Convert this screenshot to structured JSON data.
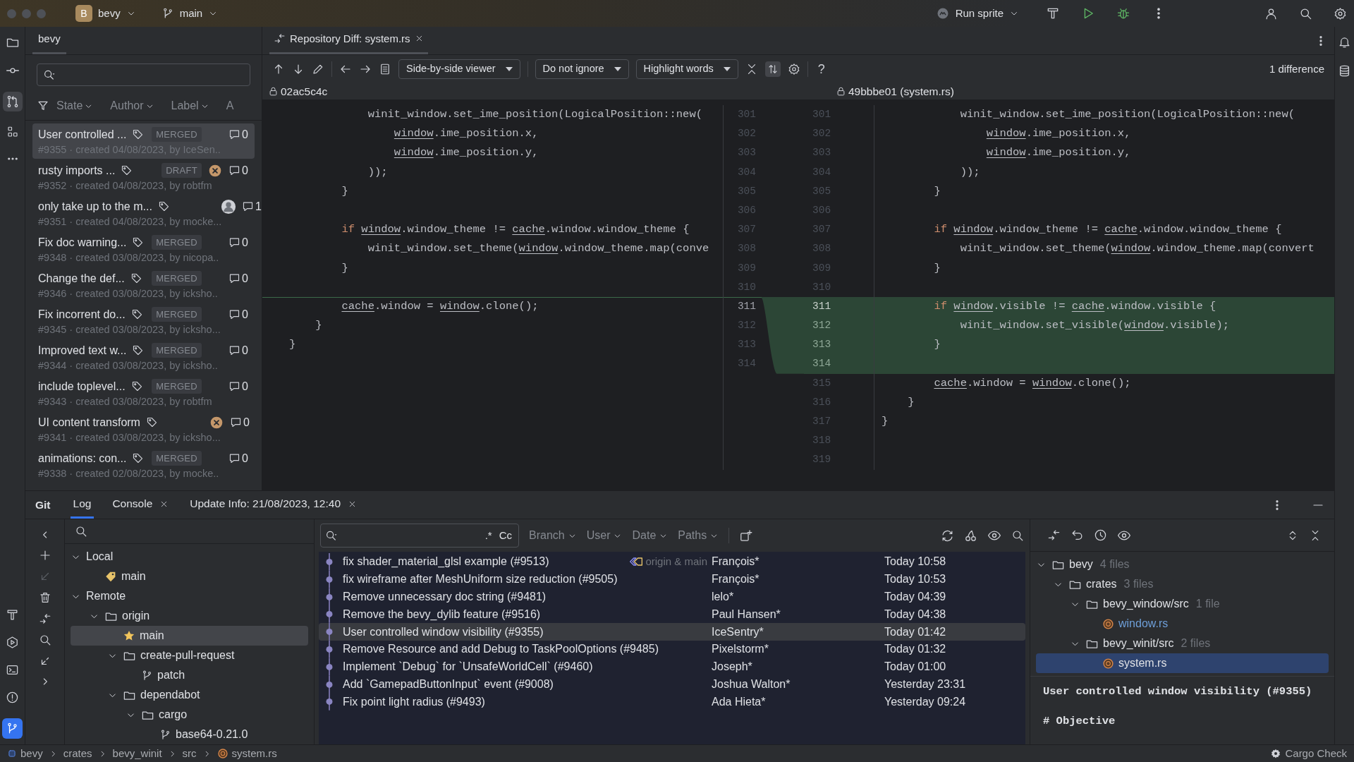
{
  "title_bar": {
    "project_initial": "B",
    "project": "bevy",
    "branch": "main",
    "run_config": "Run sprite"
  },
  "pr_panel": {
    "tab": "bevy",
    "filters": [
      "State",
      "Author",
      "Label",
      "A"
    ],
    "items": [
      {
        "title": "User controlled ...",
        "status": "MERGED",
        "failed": false,
        "avatar": false,
        "comments": "0",
        "meta": "#9355 · created 04/08/2023, by IceSen..",
        "selected": true
      },
      {
        "title": "rusty imports ...",
        "status": "DRAFT",
        "failed": true,
        "avatar": false,
        "comments": "0",
        "meta": "#9352 · created 04/08/2023, by robtfm",
        "selected": false
      },
      {
        "title": "only take up to the m...",
        "failed": false,
        "avatar": true,
        "comments": "1",
        "meta": "#9351 · created 04/08/2023, by mocke...",
        "selected": false
      },
      {
        "title": "Fix doc warning...",
        "status": "MERGED",
        "failed": false,
        "avatar": false,
        "comments": "0",
        "meta": "#9348 · created 03/08/2023, by nicopa..",
        "selected": false
      },
      {
        "title": "Change the def...",
        "status": "MERGED",
        "failed": false,
        "avatar": false,
        "comments": "0",
        "meta": "#9346 · created 03/08/2023, by icksho..",
        "selected": false
      },
      {
        "title": "Fix incorrent do...",
        "status": "MERGED",
        "failed": false,
        "avatar": false,
        "comments": "0",
        "meta": "#9345 · created 03/08/2023, by icksho...",
        "selected": false
      },
      {
        "title": "Improved text w...",
        "status": "MERGED",
        "failed": false,
        "avatar": false,
        "comments": "0",
        "meta": "#9344 · created 03/08/2023, by icksho..",
        "selected": false
      },
      {
        "title": "include toplevel...",
        "status": "MERGED",
        "failed": false,
        "avatar": false,
        "comments": "0",
        "meta": "#9343 · created 03/08/2023, by robtfm",
        "selected": false
      },
      {
        "title": "UI content transform",
        "failed": true,
        "avatar": false,
        "comments": "0",
        "meta": "#9341 · created 03/08/2023, by icksho...",
        "selected": false
      },
      {
        "title": "animations: con...",
        "status": "MERGED",
        "failed": false,
        "avatar": false,
        "comments": "0",
        "meta": "#9338 · created 02/08/2023, by mocke..",
        "selected": false
      }
    ]
  },
  "diff": {
    "tab": "Repository Diff: system.rs",
    "dropdowns": [
      "Side-by-side viewer",
      "Do not ignore",
      "Highlight words"
    ],
    "sync_scroll": true,
    "help": "?",
    "differences": "1 difference",
    "left_revision": "02ac5c4c",
    "right_revision": "49bbbe01 (system.rs)",
    "rows": [
      {
        "left_num": "301",
        "left": [
          {
            "text": "            winit_window.set_ime_position(LogicalPosition::new(",
            "kind": "plain"
          }
        ],
        "right_num": "301",
        "right": [
          {
            "text": "            winit_window.set_ime_position(LogicalPosition::new(",
            "kind": "plain"
          }
        ],
        "changed": false
      },
      {
        "left_num": "302",
        "left": [
          {
            "text": "                window",
            "kind": "ref"
          },
          {
            "text": ".ime_position.x,",
            "kind": "plain"
          }
        ],
        "right_num": "302",
        "right": [
          {
            "text": "                window",
            "kind": "ref"
          },
          {
            "text": ".ime_position.x,",
            "kind": "plain"
          }
        ],
        "changed": false
      },
      {
        "left_num": "303",
        "left": [
          {
            "text": "                window",
            "kind": "ref"
          },
          {
            "text": ".ime_position.y,",
            "kind": "plain"
          }
        ],
        "right_num": "303",
        "right": [
          {
            "text": "                window",
            "kind": "ref"
          },
          {
            "text": ".ime_position.y,",
            "kind": "plain"
          }
        ],
        "changed": false
      },
      {
        "left_num": "304",
        "left": [
          {
            "text": "            ));",
            "kind": "plain"
          }
        ],
        "right_num": "304",
        "right": [
          {
            "text": "            ));",
            "kind": "plain"
          }
        ],
        "changed": false
      },
      {
        "left_num": "305",
        "left": [
          {
            "text": "        }",
            "kind": "plain"
          }
        ],
        "right_num": "305",
        "right": [
          {
            "text": "        }",
            "kind": "plain"
          }
        ],
        "changed": false
      },
      {
        "left_num": "306",
        "left": [],
        "right_num": "306",
        "right": [],
        "changed": false
      },
      {
        "left_num": "307",
        "left": [
          {
            "text": "        if",
            "kind": "keyword"
          },
          {
            "text": " window",
            "kind": "ref"
          },
          {
            "text": ".window_theme != ",
            "kind": "plain"
          },
          {
            "text": "cache",
            "kind": "ref"
          },
          {
            "text": ".window.window_theme {",
            "kind": "plain"
          }
        ],
        "right_num": "307",
        "right": [
          {
            "text": "        if",
            "kind": "keyword"
          },
          {
            "text": " window",
            "kind": "ref"
          },
          {
            "text": ".window_theme != ",
            "kind": "plain"
          },
          {
            "text": "cache",
            "kind": "ref"
          },
          {
            "text": ".window.window_theme {",
            "kind": "plain"
          }
        ],
        "changed": false
      },
      {
        "left_num": "308",
        "left": [
          {
            "text": "            winit_window.set_theme(",
            "kind": "plain"
          },
          {
            "text": "window",
            "kind": "ref"
          },
          {
            "text": ".window_theme.map(conve",
            "kind": "plain"
          }
        ],
        "right_num": "308",
        "right": [
          {
            "text": "            winit_window.set_theme(",
            "kind": "plain"
          },
          {
            "text": "window",
            "kind": "ref"
          },
          {
            "text": ".window_theme.map(convert",
            "kind": "plain"
          }
        ],
        "changed": false
      },
      {
        "left_num": "309",
        "left": [
          {
            "text": "        }",
            "kind": "plain"
          }
        ],
        "right_num": "309",
        "right": [
          {
            "text": "        }",
            "kind": "plain"
          }
        ],
        "changed": false
      },
      {
        "left_num": "310",
        "left": [],
        "right_num": "310",
        "right": [],
        "changed": false
      },
      {
        "left_num": "311",
        "left": [
          {
            "text": "        cache",
            "kind": "ref"
          },
          {
            "text": ".window = ",
            "kind": "plain"
          },
          {
            "text": "window",
            "kind": "ref"
          },
          {
            "text": ".clone();",
            "kind": "plain"
          }
        ],
        "right_num": "311",
        "right": [
          {
            "text": "        if",
            "kind": "keyword"
          },
          {
            "text": " window",
            "kind": "ref"
          },
          {
            "text": ".visible != ",
            "kind": "plain"
          },
          {
            "text": "cache",
            "kind": "ref"
          },
          {
            "text": ".window.visible {",
            "kind": "plain"
          }
        ],
        "changed": true
      },
      {
        "left_num": "312",
        "left": [
          {
            "text": "    }",
            "kind": "plain"
          }
        ],
        "right_num": "312",
        "right": [
          {
            "text": "            winit_window.set_visible(",
            "kind": "plain"
          },
          {
            "text": "window",
            "kind": "ref"
          },
          {
            "text": ".visible);",
            "kind": "plain"
          }
        ],
        "changed": true
      },
      {
        "left_num": "313",
        "left": [
          {
            "text": "}",
            "kind": "plain"
          }
        ],
        "right_num": "313",
        "right": [
          {
            "text": "        }",
            "kind": "plain"
          }
        ],
        "changed": true
      },
      {
        "left_num": "314",
        "left": [],
        "right_num": "314",
        "right": [],
        "changed": true
      },
      {
        "left": [],
        "right_num": "315",
        "right": [
          {
            "text": "        cache",
            "kind": "ref"
          },
          {
            "text": ".window = ",
            "kind": "plain"
          },
          {
            "text": "window",
            "kind": "ref"
          },
          {
            "text": ".clone();",
            "kind": "plain"
          }
        ],
        "changed": false
      },
      {
        "left": [],
        "right_num": "316",
        "right": [
          {
            "text": "    }",
            "kind": "plain"
          }
        ],
        "changed": false
      },
      {
        "left": [],
        "right_num": "317",
        "right": [
          {
            "text": "}",
            "kind": "plain"
          }
        ],
        "changed": false
      },
      {
        "left": [],
        "right_num": "318",
        "right": [],
        "changed": false
      },
      {
        "left": [],
        "right_num": "319",
        "right": [],
        "changed": false
      }
    ]
  },
  "git_panel": {
    "title": "Git",
    "tabs": [
      {
        "label": "Log",
        "selected": true,
        "closable": false
      },
      {
        "label": "Console",
        "selected": false,
        "closable": true
      },
      {
        "label": "Update Info: 21/08/2023, 12:40",
        "selected": false,
        "closable": true
      }
    ],
    "branches": [
      {
        "label": "Local",
        "expanded": true,
        "selected": false,
        "children": [
          {
            "label": "main",
            "kind": "local-branch",
            "selected": false
          }
        ]
      },
      {
        "label": "Remote",
        "expanded": true,
        "selected": false,
        "children": [
          {
            "label": "origin",
            "kind": "folder",
            "expanded": true,
            "selected": false,
            "children": [
              {
                "label": "main",
                "kind": "favorite",
                "selected": true
              },
              {
                "label": "create-pull-request",
                "kind": "folder",
                "expanded": true,
                "selected": false,
                "children": [
                  {
                    "label": "patch",
                    "kind": "branch",
                    "selected": false
                  }
                ]
              },
              {
                "label": "dependabot",
                "kind": "folder",
                "expanded": true,
                "selected": false,
                "children": [
                  {
                    "label": "cargo",
                    "kind": "folder",
                    "expanded": true,
                    "selected": false,
                    "children": [
                      {
                        "label": "base64-0.21.0",
                        "kind": "branch",
                        "selected": false
                      }
                    ]
                  }
                ]
              }
            ]
          }
        ]
      }
    ],
    "log_search": {
      "regex": ".*",
      "case": "Cc"
    },
    "log_filters": [
      "Branch",
      "User",
      "Date",
      "Paths"
    ],
    "commits": [
      {
        "subject": "fix shader_material_glsl example (#9513)",
        "refs": "origin & main",
        "author": "François*",
        "date": "Today 10:58",
        "selected": false
      },
      {
        "subject": "fix wireframe after MeshUniform size reduction (#9505)",
        "author": "François*",
        "date": "Today 10:53",
        "selected": false
      },
      {
        "subject": "Remove unnecessary doc string (#9481)",
        "author": "lelo*",
        "date": "Today 04:39",
        "selected": false
      },
      {
        "subject": "Remove the bevy_dylib feature (#9516)",
        "author": "Paul Hansen*",
        "date": "Today 04:38",
        "selected": false
      },
      {
        "subject": "User controlled window visibility (#9355)",
        "author": "IceSentry*",
        "date": "Today 01:42",
        "selected": true
      },
      {
        "subject": "Remove Resource and add Debug to TaskPoolOptions (#9485)",
        "author": "Pixelstorm*",
        "date": "Today 01:32",
        "selected": false
      },
      {
        "subject": "Implement `Debug` for `UnsafeWorldCell` (#9460)",
        "author": "Joseph*",
        "date": "Today 01:00",
        "selected": false
      },
      {
        "subject": "Add `GamepadButtonInput` event (#9008)",
        "author": "Joshua Walton*",
        "date": "Yesterday 23:31",
        "selected": false
      },
      {
        "subject": "Fix point light radius (#9493)",
        "author": "Ada Hieta*",
        "date": "Yesterday 09:24",
        "selected": false
      }
    ],
    "changes": [
      {
        "label": "bevy",
        "count": "4 files",
        "kind": "folder",
        "expanded": true,
        "selected": false,
        "children": [
          {
            "label": "crates",
            "count": "3 files",
            "kind": "folder",
            "expanded": true,
            "selected": false,
            "children": [
              {
                "label": "bevy_window/src",
                "count": "1 file",
                "kind": "folder",
                "expanded": true,
                "selected": false,
                "children": [
                  {
                    "label": "window.rs",
                    "kind": "rust-file",
                    "selected": false
                  }
                ]
              },
              {
                "label": "bevy_winit/src",
                "count": "2 files",
                "kind": "folder",
                "expanded": true,
                "selected": false,
                "children": [
                  {
                    "label": "system.rs",
                    "kind": "rust-file",
                    "selected": true
                  }
                ]
              }
            ]
          }
        ]
      }
    ],
    "commit_message": {
      "title": "User controlled window visibility (#9355)",
      "body": "# Objective"
    }
  },
  "status_bar": {
    "breadcrumbs": [
      {
        "label": "bevy",
        "kind": "module"
      },
      {
        "label": "crates"
      },
      {
        "label": "bevy_winit"
      },
      {
        "label": "src"
      },
      {
        "label": "system.rs",
        "kind": "rust-file"
      }
    ],
    "task": "Cargo Check"
  }
}
